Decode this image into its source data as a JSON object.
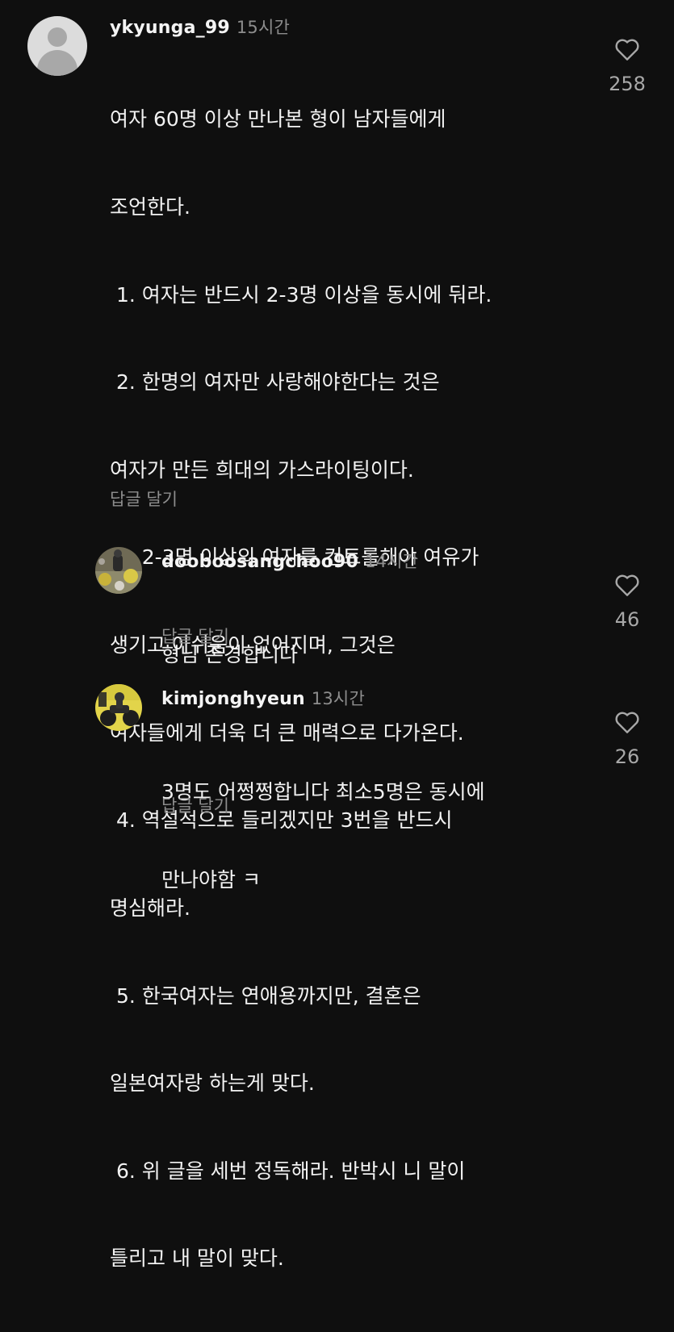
{
  "comments": [
    {
      "username": "ykyunga_99",
      "time": "15시간",
      "text_lines": [
        "여자 60명 이상 만나본 형이 남자들에게",
        "조언한다.",
        " 1. 여자는 반드시 2-3명 이상을 동시에 둬라.",
        " 2. 한명의 여자만 사랑해야한다는 것은",
        "여자가 만든 희대의 가스라이팅이다.",
        " 3. 2-3명 이상의 여자를 컨트롤해야 여유가",
        "생기고 아쉬움이 없어지며, 그것은",
        "여자들에게 더욱 더 큰 매력으로 다가온다.",
        " 4. 역설적으로 들리겠지만 3번을 반드시",
        "명심해라.",
        " 5. 한국여자는 연애용까지만, 결혼은",
        "일본여자랑 하는게 맞다.",
        " 6. 위 글을 세번 정독해라. 반박시 니 말이",
        "틀리고 내 말이 맞다."
      ],
      "reply_label": "답글 달기",
      "likes": "258"
    },
    {
      "username": "dooboosangchoo90",
      "time": "14시간",
      "text_lines": [
        "형님 존경합니다"
      ],
      "reply_label": "답글 달기",
      "likes": "46"
    },
    {
      "username": "kimjonghyeun",
      "time": "13시간",
      "text_lines": [
        "3명도 어쩡쩡합니다 최소5명은 동시에",
        "만나야함 ㅋ"
      ],
      "reply_label": "답글 달기",
      "likes": "26"
    }
  ],
  "colors": {
    "background": "#0f0f0f",
    "text": "#f2f2f2",
    "muted": "#8d8d8d"
  },
  "icons": [
    "heart-outline-icon",
    "default-avatar-icon"
  ]
}
